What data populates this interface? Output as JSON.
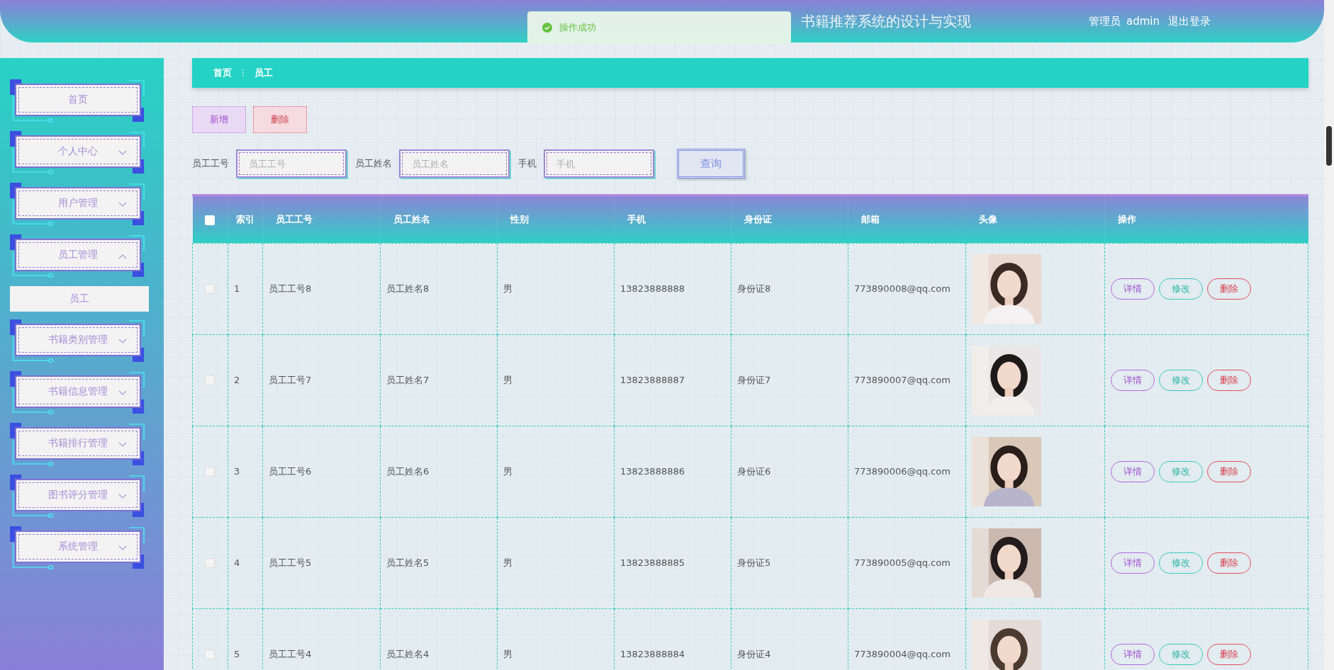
{
  "header": {
    "title": "书籍推荐系统的设计与实现",
    "user_role": "管理员",
    "user_name": "admin",
    "logout": "退出登录"
  },
  "toast": {
    "kind": "success",
    "message": "操作成功"
  },
  "sidebar": {
    "items": [
      {
        "kind": "link",
        "label": "首页"
      },
      {
        "kind": "menu",
        "label": "个人中心",
        "expanded": false
      },
      {
        "kind": "menu",
        "label": "用户管理",
        "expanded": false
      },
      {
        "kind": "menu",
        "label": "员工管理",
        "expanded": true,
        "children": [
          {
            "label": "员工"
          }
        ]
      },
      {
        "kind": "menu",
        "label": "书籍类别管理",
        "expanded": false
      },
      {
        "kind": "menu",
        "label": "书籍信息管理",
        "expanded": false
      },
      {
        "kind": "menu",
        "label": "书籍排行管理",
        "expanded": false
      },
      {
        "kind": "menu",
        "label": "图书评分管理",
        "expanded": false
      },
      {
        "kind": "menu",
        "label": "系统管理",
        "expanded": false
      }
    ]
  },
  "breadcrumb": [
    "首页",
    "员工"
  ],
  "breadcrumb_separator": "⋮",
  "toolbar": {
    "buttons": [
      {
        "kind": "add",
        "label": "新增"
      },
      {
        "kind": "delete",
        "label": "删除"
      }
    ]
  },
  "search": {
    "fields": [
      {
        "label": "员工工号",
        "placeholder": "员工工号"
      },
      {
        "label": "员工姓名",
        "placeholder": "员工姓名"
      },
      {
        "label": "手机",
        "placeholder": "手机"
      }
    ],
    "button": "查询"
  },
  "table": {
    "select_all_checked": false,
    "columns": [
      "索引",
      "员工工号",
      "员工姓名",
      "性别",
      "手机",
      "身份证",
      "邮箱",
      "头像",
      "操作"
    ],
    "rows": [
      {
        "checked": false,
        "index": "1",
        "id": "员工工号8",
        "name": "员工姓名8",
        "gender": "男",
        "phone": "13823888888",
        "id_card": "身份证8",
        "email": "773890008@qq.com",
        "actions": [
          "详情",
          "修改",
          "删除"
        ]
      },
      {
        "checked": false,
        "index": "2",
        "id": "员工工号7",
        "name": "员工姓名7",
        "gender": "男",
        "phone": "13823888887",
        "id_card": "身份证7",
        "email": "773890007@qq.com",
        "actions": [
          "详情",
          "修改",
          "删除"
        ]
      },
      {
        "checked": false,
        "index": "3",
        "id": "员工工号6",
        "name": "员工姓名6",
        "gender": "男",
        "phone": "13823888886",
        "id_card": "身份证6",
        "email": "773890006@qq.com",
        "actions": [
          "详情",
          "修改",
          "删除"
        ]
      },
      {
        "checked": false,
        "index": "4",
        "id": "员工工号5",
        "name": "员工姓名5",
        "gender": "男",
        "phone": "13823888885",
        "id_card": "身份证5",
        "email": "773890005@qq.com",
        "actions": [
          "详情",
          "修改",
          "删除"
        ]
      },
      {
        "checked": false,
        "index": "5",
        "id": "员工工号4",
        "name": "员工姓名4",
        "gender": "男",
        "phone": "13823888884",
        "id_card": "身份证4",
        "email": "773890004@qq.com",
        "actions": [
          "详情",
          "修改",
          "删除"
        ]
      }
    ]
  }
}
